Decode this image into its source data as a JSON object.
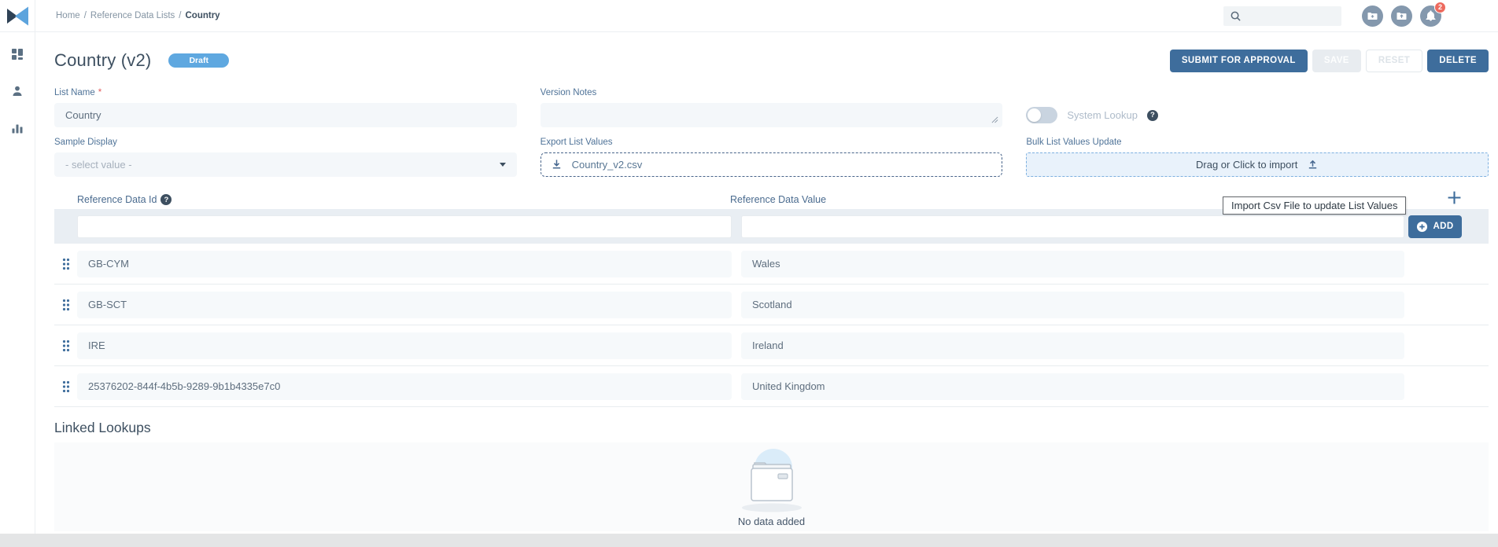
{
  "topbar": {
    "breadcrumb": {
      "items": [
        "Home",
        "Reference Data Lists",
        "Country"
      ],
      "separator": "/"
    },
    "search_value": "",
    "notification_count": "2"
  },
  "header": {
    "title": "Country (v2)",
    "badge": "Draft",
    "submit_label": "SUBMIT FOR APPROVAL",
    "save_label": "SAVE",
    "reset_label": "RESET",
    "delete_label": "DELETE"
  },
  "form": {
    "list_name": {
      "label": "List Name",
      "required_mark": "*",
      "value": "Country"
    },
    "version_notes": {
      "label": "Version Notes",
      "value": ""
    },
    "system_lookup": {
      "label": "System Lookup",
      "state": "off",
      "help": "?"
    },
    "sample_display": {
      "label": "Sample Display",
      "placeholder": "- select value -"
    },
    "export_list": {
      "label": "Export List Values",
      "file": "Country_v2.csv"
    },
    "bulk_update": {
      "label": "Bulk List Values Update",
      "drop_label": "Drag or Click to import"
    }
  },
  "tooltip": {
    "text": "Import Csv File to update List Values"
  },
  "table": {
    "col_id": "Reference Data Id",
    "col_id_help": "?",
    "col_value": "Reference Data Value",
    "add_label": "ADD",
    "rows": [
      {
        "id": "GB-CYM",
        "value": "Wales"
      },
      {
        "id": "GB-SCT",
        "value": "Scotland"
      },
      {
        "id": "IRE",
        "value": "Ireland"
      },
      {
        "id": "25376202-844f-4b5b-9289-9b1b4335e7c0",
        "value": "United Kingdom"
      }
    ]
  },
  "linked_lookups": {
    "title": "Linked Lookups",
    "empty_text": "No data added"
  },
  "colors": {
    "primary_button": "#3e6d9c",
    "status_badge_blue": "#5fa8e0",
    "notification_red": "#ed6a5e",
    "bulk_drop_bg": "#e9f2fb",
    "bulk_drop_border": "#7db0e0",
    "filter_band_bg": "#e9eef3",
    "field_bg": "#f4f7fa",
    "label_blue": "#4f7398"
  }
}
